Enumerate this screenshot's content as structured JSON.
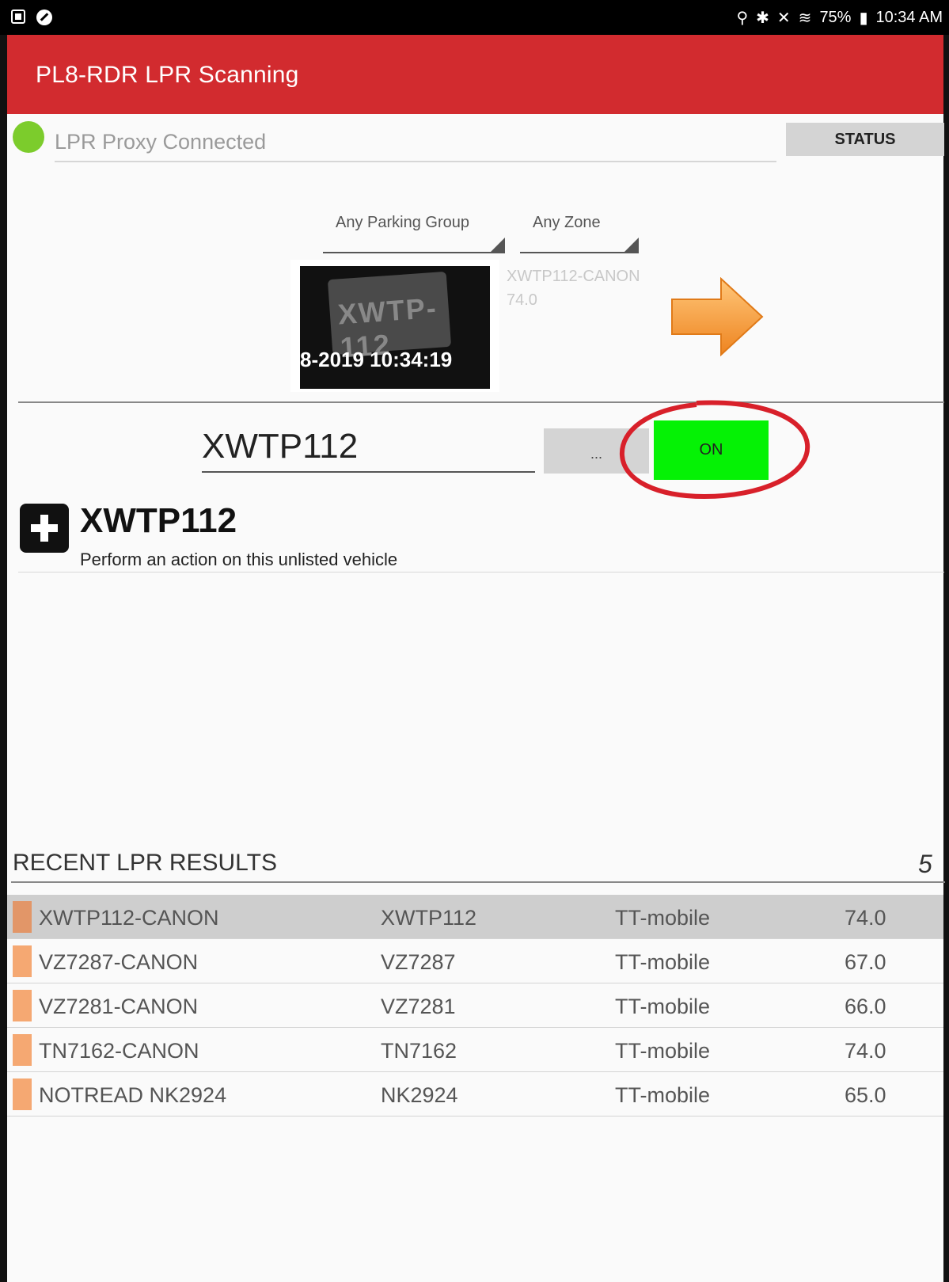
{
  "status_bar": {
    "battery": "75%",
    "time": "10:34 AM"
  },
  "app": {
    "title": "PL8-RDR LPR Scanning",
    "accent_color": "#d22b2f"
  },
  "connection": {
    "text": "LPR Proxy Connected",
    "status_color": "#7ccc2c",
    "status_button": "STATUS"
  },
  "filters": {
    "parking_group": "Any Parking Group",
    "zone": "Any Zone"
  },
  "read": {
    "timestamp_overlay": "8-2019 10:34:19",
    "plate_image_text": "XWTP-112",
    "read_id": "XWTP112-CANON",
    "score": "74.0"
  },
  "plate_entry": {
    "value": "XWTP112",
    "more_label": "...",
    "toggle_label": "ON",
    "toggle_color": "#05f205"
  },
  "action": {
    "title": "XWTP112",
    "subtitle": "Perform an action on this unlisted vehicle"
  },
  "recent": {
    "header": "RECENT LPR RESULTS",
    "count": "5",
    "rows": [
      {
        "read_id": "XWTP112-CANON",
        "plate": "XWTP112",
        "source": "TT-mobile",
        "score": "74.0"
      },
      {
        "read_id": "VZ7287-CANON",
        "plate": "VZ7287",
        "source": "TT-mobile",
        "score": "67.0"
      },
      {
        "read_id": "VZ7281-CANON",
        "plate": "VZ7281",
        "source": "TT-mobile",
        "score": "66.0"
      },
      {
        "read_id": "TN7162-CANON",
        "plate": "TN7162",
        "source": "TT-mobile",
        "score": "74.0"
      },
      {
        "read_id": "NOTREAD NK2924",
        "plate": "NK2924",
        "source": "TT-mobile",
        "score": "65.0"
      }
    ]
  }
}
